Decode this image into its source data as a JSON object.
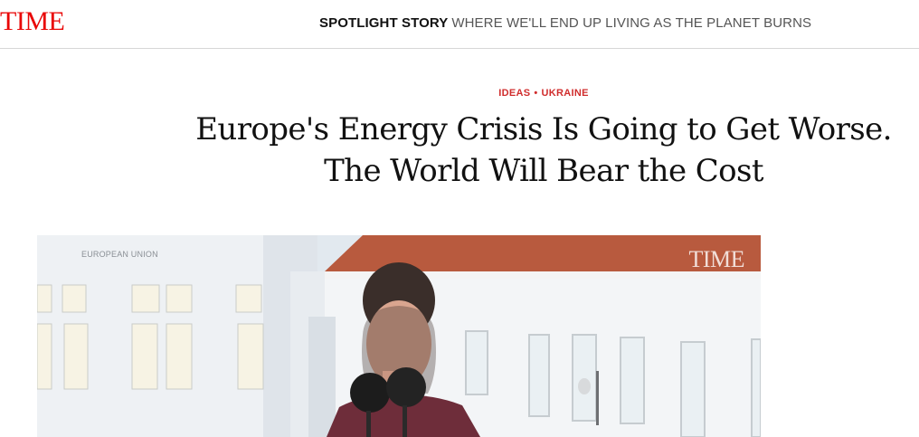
{
  "header": {
    "logo": "TIME",
    "spotlight_kicker": "SPOTLIGHT STORY",
    "spotlight_title": "WHERE WE'LL END UP LIVING AS THE PLANET BURNS"
  },
  "article": {
    "tags": [
      "IDEAS",
      "UKRAINE"
    ],
    "headline_line1": "Europe's Energy Crisis Is Going to Get Worse.",
    "headline_line2": "The World Will Bear the Cost"
  },
  "hero": {
    "overlay_label": "EUROPEAN UNION",
    "watermark": "TIME"
  },
  "colors": {
    "brand_red": "#e90606",
    "tag_red": "#d02d2d",
    "text": "#111111"
  }
}
